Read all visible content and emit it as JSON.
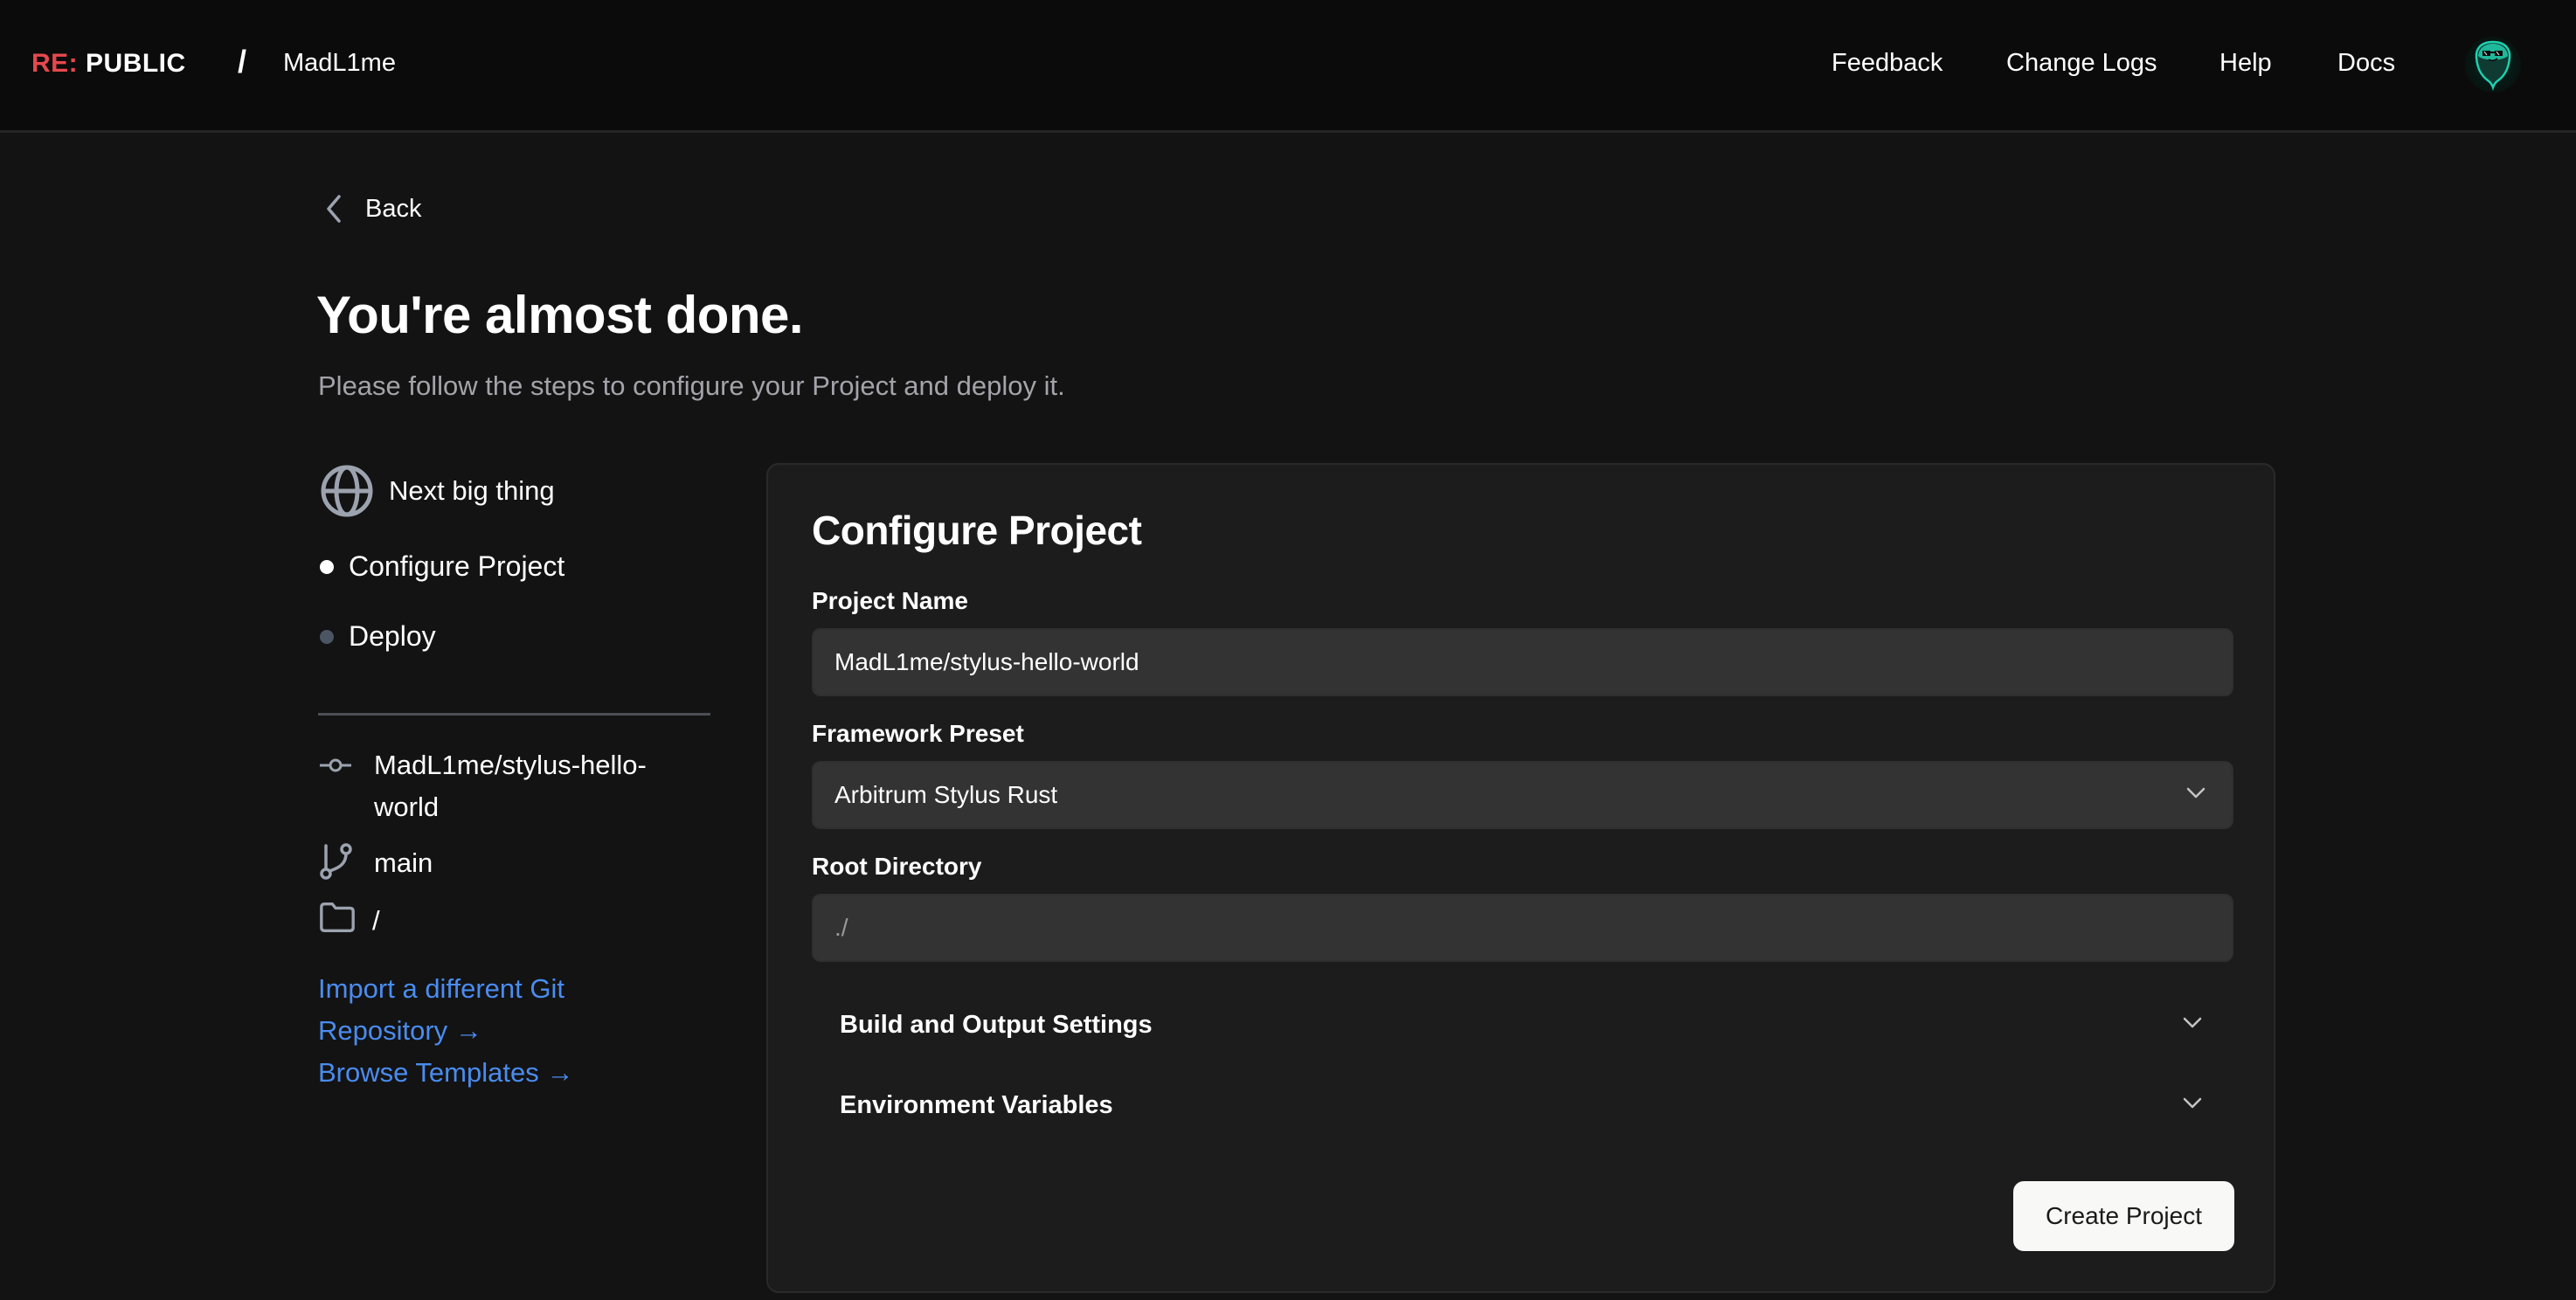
{
  "header": {
    "logo": {
      "prefix": "RE:",
      "suffix": "PUBLIC"
    },
    "breadcrumb_separator": "/",
    "breadcrumb_user": "MadL1me",
    "nav": [
      {
        "label": "Feedback"
      },
      {
        "label": "Change Logs"
      },
      {
        "label": "Help"
      },
      {
        "label": "Docs"
      }
    ],
    "avatar_icon": "ghost-avatar-icon"
  },
  "page": {
    "back_label": "Back",
    "title": "You're almost done.",
    "subtitle": "Please follow the steps to configure your Project and deploy it."
  },
  "sidebar": {
    "project_name": "Next big thing",
    "project_icon": "globe-icon",
    "steps": [
      {
        "label": "Configure Project",
        "state": "active",
        "dot_color": "#ffffff"
      },
      {
        "label": "Deploy",
        "state": "pending",
        "dot_color": "#4b5563"
      }
    ],
    "repo": {
      "icon": "commit-icon",
      "value": "MadL1me/stylus-hello-world"
    },
    "branch": {
      "icon": "git-branch-icon",
      "value": "main"
    },
    "directory": {
      "icon": "folder-icon",
      "value": "/"
    },
    "links": [
      {
        "label": "Import a different Git Repository →"
      },
      {
        "label": "Browse Templates →"
      }
    ]
  },
  "card": {
    "title": "Configure Project",
    "project_name": {
      "label": "Project Name",
      "value": "MadL1me/stylus-hello-world"
    },
    "framework": {
      "label": "Framework Preset",
      "selected": "Arbitrum Stylus Rust"
    },
    "root_directory": {
      "label": "Root Directory",
      "placeholder": "./",
      "value": ""
    },
    "accordions": [
      {
        "label": "Build and Output Settings",
        "expanded": false
      },
      {
        "label": "Environment Variables",
        "expanded": false
      }
    ],
    "submit_label": "Create Project"
  },
  "colors": {
    "brand_red": "#e5484d",
    "link_blue": "#4a8cf0",
    "avatar_teal": "#1fb89a"
  }
}
